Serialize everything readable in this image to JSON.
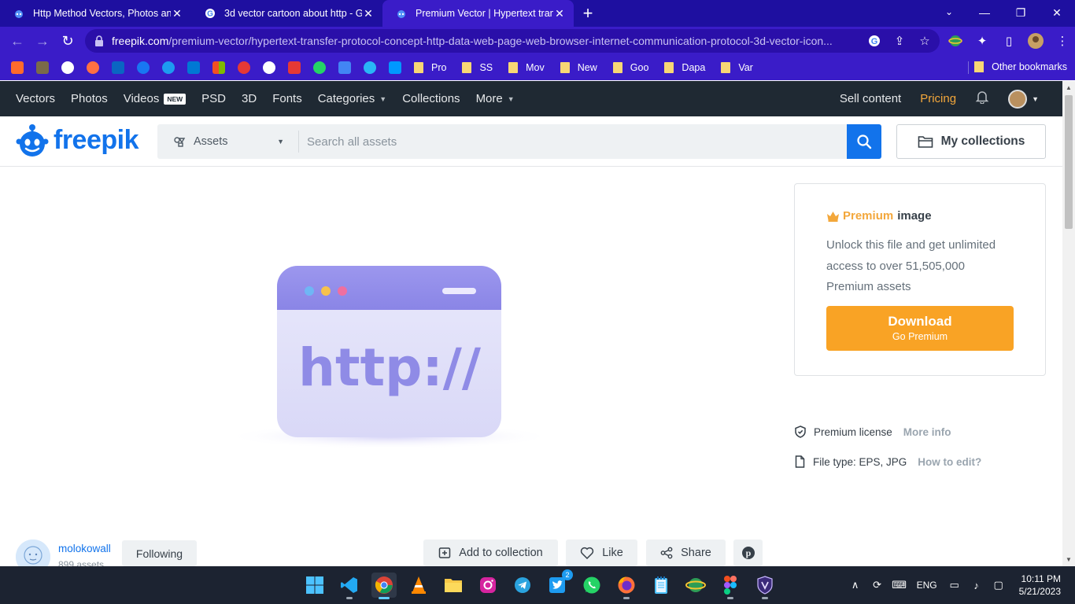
{
  "browser": {
    "tabs": [
      {
        "title": "Http Method Vectors, Photos and",
        "active": false
      },
      {
        "title": "3d vector cartoon about http - G",
        "active": false
      },
      {
        "title": "Premium Vector | Hypertext trans",
        "active": true
      }
    ],
    "url_domain": "freepik.com",
    "url_path": "/premium-vector/hypertext-transfer-protocol-concept-http-data-web-page-web-browser-internet-communication-protocol-3d-vector-icon...",
    "bookmark_folders": [
      "Pro",
      "SS",
      "Mov",
      "New",
      "Goo",
      "Dapa",
      "Var"
    ],
    "other_bookmarks": "Other bookmarks"
  },
  "nav": {
    "items": [
      "Vectors",
      "Photos",
      "Videos",
      "PSD",
      "3D",
      "Fonts",
      "Categories",
      "Collections",
      "More"
    ],
    "videos_badge": "NEW",
    "sell": "Sell content",
    "pricing": "Pricing"
  },
  "header": {
    "logo": "freepik",
    "assets_label": "Assets",
    "search_placeholder": "Search all assets",
    "my_collections": "My collections"
  },
  "preview": {
    "text": "http://"
  },
  "premium": {
    "word": "Premium",
    "suffix": "image",
    "description": "Unlock this file and get unlimited access to over 51,505,000 Premium assets",
    "download": "Download",
    "go_premium": "Go Premium"
  },
  "meta": {
    "license_label": "Premium license",
    "license_link": "More info",
    "filetype_label": "File type: EPS, JPG",
    "filetype_link": "How to edit?"
  },
  "author": {
    "name": "molokowall",
    "count": "899 assets",
    "follow": "Following"
  },
  "actions": {
    "add": "Add to collection",
    "like": "Like",
    "share": "Share"
  },
  "taskbar": {
    "lang": "ENG",
    "time": "10:11 PM",
    "date": "5/21/2023",
    "twitter_badge": "2"
  },
  "colors": {
    "tab_bg": "#1e0fa0",
    "toolbar_bg": "#3a1cc8",
    "freepik_blue": "#1273eb",
    "premium_orange": "#f9a325",
    "nav_bg": "#1f2933"
  }
}
